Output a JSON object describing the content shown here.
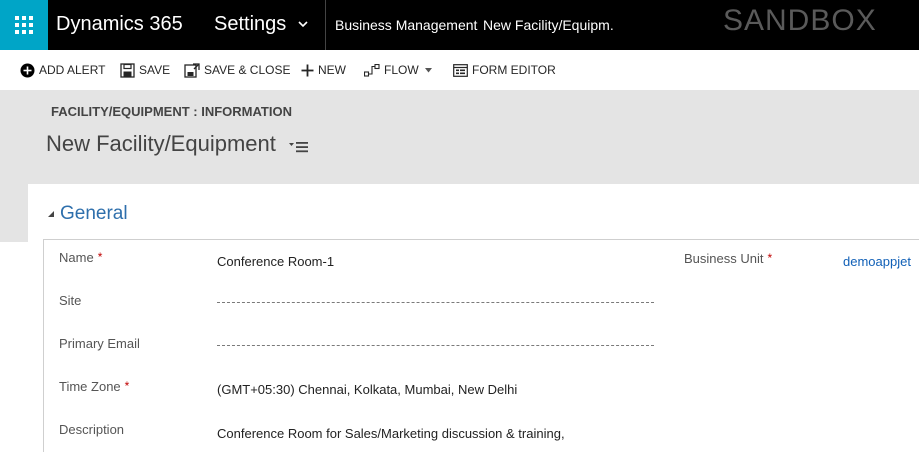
{
  "topbar": {
    "app_title": "Dynamics 365",
    "area_title": "Settings",
    "breadcrumb_area": "Business Management",
    "breadcrumb_record": "New Facility/Equipm.",
    "environment_badge": "SANDBOX",
    "waffle_color": "#00a5c7",
    "icons": [
      "waffle-icon",
      "chevron-down-icon"
    ]
  },
  "commands": {
    "add_alert": "ADD ALERT",
    "save": "SAVE",
    "save_close": "SAVE & CLOSE",
    "new": "NEW",
    "flow": "FLOW",
    "form_editor": "FORM EDITOR"
  },
  "header": {
    "entity_form": "FACILITY/EQUIPMENT : INFORMATION",
    "record_title": "New Facility/Equipment"
  },
  "section": {
    "title": "General",
    "title_color": "#2e6fac"
  },
  "fields": {
    "name": {
      "label": "Name",
      "required": "*",
      "value": "Conference Room-1"
    },
    "site": {
      "label": "Site",
      "value": ""
    },
    "primary_email": {
      "label": "Primary Email",
      "value": ""
    },
    "time_zone": {
      "label": "Time Zone",
      "required": "*",
      "value": "(GMT+05:30) Chennai, Kolkata, Mumbai, New Delhi"
    },
    "description": {
      "label": "Description",
      "value": "Conference Room for Sales/Marketing discussion & training,"
    },
    "business_unit": {
      "label": "Business Unit",
      "required": "*",
      "value": "demoappjet"
    }
  }
}
